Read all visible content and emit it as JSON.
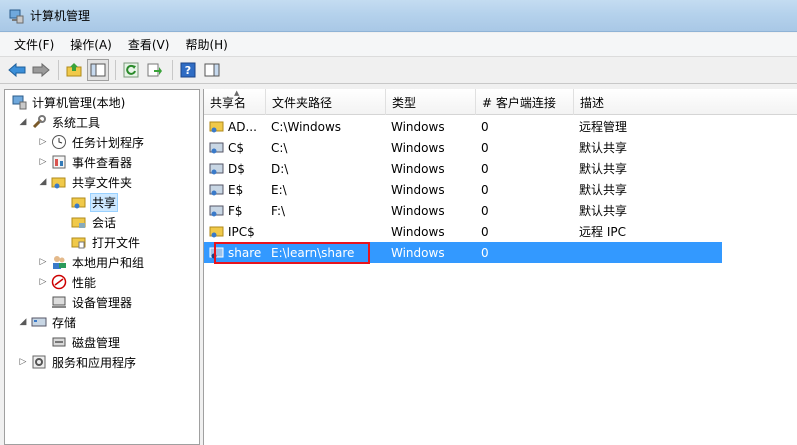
{
  "window": {
    "title": "计算机管理"
  },
  "menu": [
    {
      "label": "文件(F)"
    },
    {
      "label": "操作(A)"
    },
    {
      "label": "查看(V)"
    },
    {
      "label": "帮助(H)"
    }
  ],
  "toolbar": {
    "buttons": [
      "back-arrow-icon",
      "forward-arrow-icon",
      "up-folder-icon",
      "show-hide-tree-icon",
      "refresh-icon",
      "export-list-icon",
      "help-icon",
      "properties-pane-icon"
    ]
  },
  "tree": {
    "root": "计算机管理(本地)",
    "items": [
      {
        "label": "计算机管理(本地)"
      },
      {
        "label": "系统工具"
      },
      {
        "label": "任务计划程序"
      },
      {
        "label": "事件查看器"
      },
      {
        "label": "共享文件夹"
      },
      {
        "label": "共享"
      },
      {
        "label": "会话"
      },
      {
        "label": "打开文件"
      },
      {
        "label": "本地用户和组"
      },
      {
        "label": "性能"
      },
      {
        "label": "设备管理器"
      },
      {
        "label": "存储"
      },
      {
        "label": "磁盘管理"
      },
      {
        "label": "服务和应用程序"
      }
    ]
  },
  "list": {
    "columns": [
      {
        "label": "共享名"
      },
      {
        "label": "文件夹路径"
      },
      {
        "label": "类型"
      },
      {
        "label": "# 客户端连接"
      },
      {
        "label": "描述"
      }
    ],
    "rows": [
      {
        "name": "AD...",
        "path": "C:\\Windows",
        "type": "Windows",
        "clients": "0",
        "desc": "远程管理"
      },
      {
        "name": "C$",
        "path": "C:\\",
        "type": "Windows",
        "clients": "0",
        "desc": "默认共享"
      },
      {
        "name": "D$",
        "path": "D:\\",
        "type": "Windows",
        "clients": "0",
        "desc": "默认共享"
      },
      {
        "name": "E$",
        "path": "E:\\",
        "type": "Windows",
        "clients": "0",
        "desc": "默认共享"
      },
      {
        "name": "F$",
        "path": "F:\\",
        "type": "Windows",
        "clients": "0",
        "desc": "默认共享"
      },
      {
        "name": "IPC$",
        "path": "",
        "type": "Windows",
        "clients": "0",
        "desc": "远程 IPC"
      },
      {
        "name": "share",
        "path": "E:\\learn\\share",
        "type": "Windows",
        "clients": "0",
        "desc": ""
      }
    ]
  },
  "colors": {
    "selection": "#3399ff",
    "annotation": "#e8141c"
  }
}
